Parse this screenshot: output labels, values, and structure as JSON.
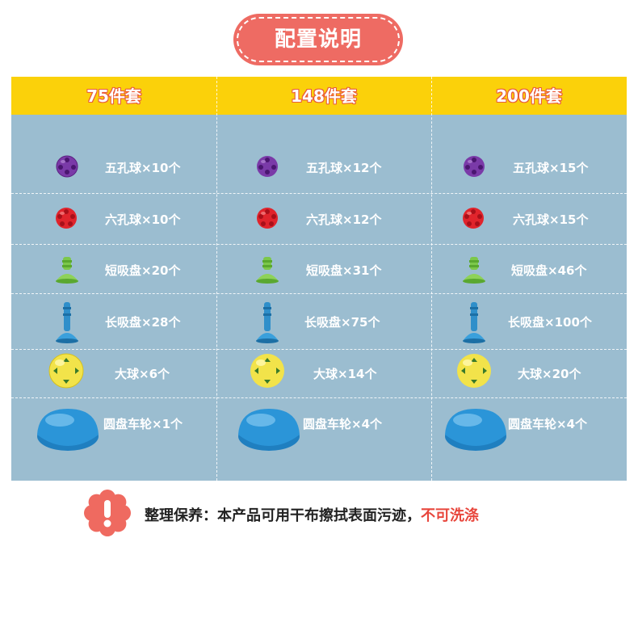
{
  "title": "配置说明",
  "columns": [
    "75件套",
    "148件套",
    "200件套"
  ],
  "rows": [
    {
      "icon": "purple-five-hole-ball-icon",
      "labels": [
        "五孔球×10个",
        "五孔球×12个",
        "五孔球×15个"
      ]
    },
    {
      "icon": "red-six-hole-ball-icon",
      "labels": [
        "六孔球×10个",
        "六孔球×12个",
        "六孔球×15个"
      ]
    },
    {
      "icon": "green-short-suction-cup-icon",
      "labels": [
        "短吸盘×20个",
        "短吸盘×31个",
        "短吸盘×46个"
      ]
    },
    {
      "icon": "blue-long-suction-cup-icon",
      "labels": [
        "长吸盘×28个",
        "长吸盘×75个",
        "长吸盘×100个"
      ]
    },
    {
      "icon": "yellow-big-ball-icon",
      "labels": [
        "大球×6个",
        "大球×14个",
        "大球×20个"
      ]
    },
    {
      "icon": "blue-disc-wheel-icon",
      "labels": [
        "圆盘车轮×1个",
        "圆盘车轮×4个",
        "圆盘车轮×4个"
      ]
    }
  ],
  "note": {
    "prefix": "整理保养：本产品可用干布擦拭表面污迹，",
    "warning": "不可洗涤"
  },
  "colors": {
    "title_bg": "#ee6b63",
    "header_bg": "#fbd10a",
    "header_text_outline": "#ea5b3a",
    "table_bg": "#9bbdd0",
    "warning_text": "#e8463c"
  }
}
